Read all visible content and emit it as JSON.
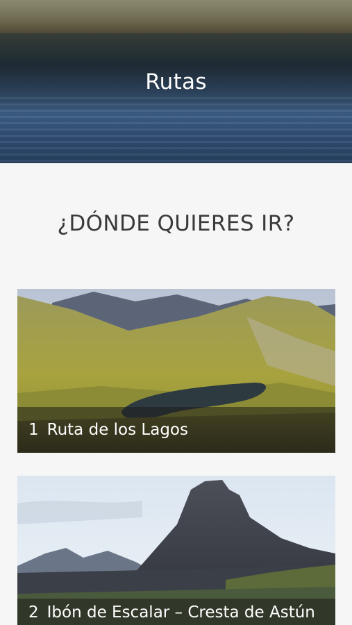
{
  "header": {
    "title": "Rutas"
  },
  "section": {
    "heading": "¿DÓNDE QUIERES IR?"
  },
  "routes": [
    {
      "number": "1",
      "name": "Ruta de los Lagos",
      "image": "mountain-lake-photo"
    },
    {
      "number": "2",
      "name": "Ibón de Escalar – Cresta de Astún",
      "image": "rocky-peak-photo"
    }
  ],
  "colors": {
    "background": "#f6f6f6",
    "heading": "#3a3a3a",
    "label_text": "#ffffff"
  }
}
